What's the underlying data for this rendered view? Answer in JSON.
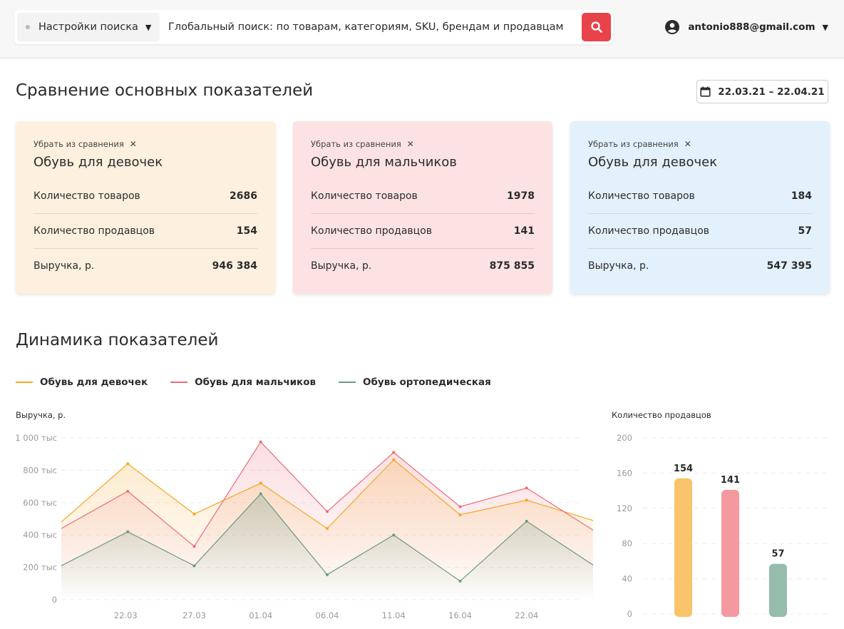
{
  "header": {
    "settings_label": "Настройки поиска",
    "search_placeholder": "Глобальный поиск: по товарам, категориям, SKU, брендам и продавцам",
    "user_email": "antonio888@gmail.com"
  },
  "comparison": {
    "title": "Сравнение основных показателей",
    "date_range": "22.03.21 – 22.04.21",
    "cards": [
      {
        "remove_label": "Убрать из сравнения",
        "title": "Обувь для девочек",
        "bg": "#fdf0de",
        "metrics": [
          {
            "label": "Количество товаров",
            "value": "2686"
          },
          {
            "label": "Количество продавцов",
            "value": "154"
          },
          {
            "label": "Выручка, р.",
            "value": "946 384"
          }
        ]
      },
      {
        "remove_label": "Убрать из сравнения",
        "title": "Обувь для мальчиков",
        "bg": "#fde2e4",
        "metrics": [
          {
            "label": "Количество товаров",
            "value": "1978"
          },
          {
            "label": "Количество продавцов",
            "value": "141"
          },
          {
            "label": "Выручка, р.",
            "value": "875 855"
          }
        ]
      },
      {
        "remove_label": "Убрать из сравнения",
        "title": "Обувь для девочек",
        "bg": "#e3f1fd",
        "metrics": [
          {
            "label": "Количество товаров",
            "value": "184"
          },
          {
            "label": "Количество продавцов",
            "value": "57"
          },
          {
            "label": "Выручка, р.",
            "value": "547 395"
          }
        ]
      }
    ]
  },
  "dynamics": {
    "title": "Динамика показателей",
    "legend": [
      {
        "name": "Обувь для девочек",
        "color": "#f5a623"
      },
      {
        "name": "Обувь для мальчиков",
        "color": "#ec6a78"
      },
      {
        "name": "Обувь ортопедическая",
        "color": "#6a9a86"
      }
    ]
  },
  "chart_data": [
    {
      "type": "area",
      "ylabel": "Выручка, р.",
      "ylim": [
        0,
        1000000
      ],
      "y_ticks": [
        "0",
        "200 тыс",
        "400 тыс",
        "600 тыс",
        "800 тыс",
        "1 000 тыс"
      ],
      "x_ticks": [
        "22.03",
        "27.03",
        "01.04",
        "06.04",
        "11.04",
        "16.04",
        "22.04"
      ],
      "grid": true,
      "series": [
        {
          "name": "Обувь для девочек",
          "color": "#f5a623",
          "values": [
            480000,
            840000,
            530000,
            720000,
            440000,
            865000,
            525000,
            615000,
            490000
          ]
        },
        {
          "name": "Обувь для мальчиков",
          "color": "#ec6a78",
          "values": [
            440000,
            670000,
            330000,
            975000,
            545000,
            910000,
            575000,
            690000,
            430000
          ]
        },
        {
          "name": "Обувь ортопедическая",
          "color": "#6a9a86",
          "values": [
            210000,
            420000,
            210000,
            655000,
            155000,
            400000,
            115000,
            485000,
            215000
          ]
        }
      ]
    },
    {
      "type": "bar",
      "ylabel": "Количество продавцов",
      "ylim": [
        0,
        200
      ],
      "y_ticks": [
        "0",
        "40",
        "80",
        "120",
        "160",
        "200"
      ],
      "grid": true,
      "categories": [
        "Обувь для девочек",
        "Обувь для мальчиков",
        "Обувь ортопедическая"
      ],
      "values": [
        154,
        141,
        57
      ],
      "colors": [
        "#f9c46b",
        "#f3999f",
        "#96bcab"
      ]
    }
  ]
}
